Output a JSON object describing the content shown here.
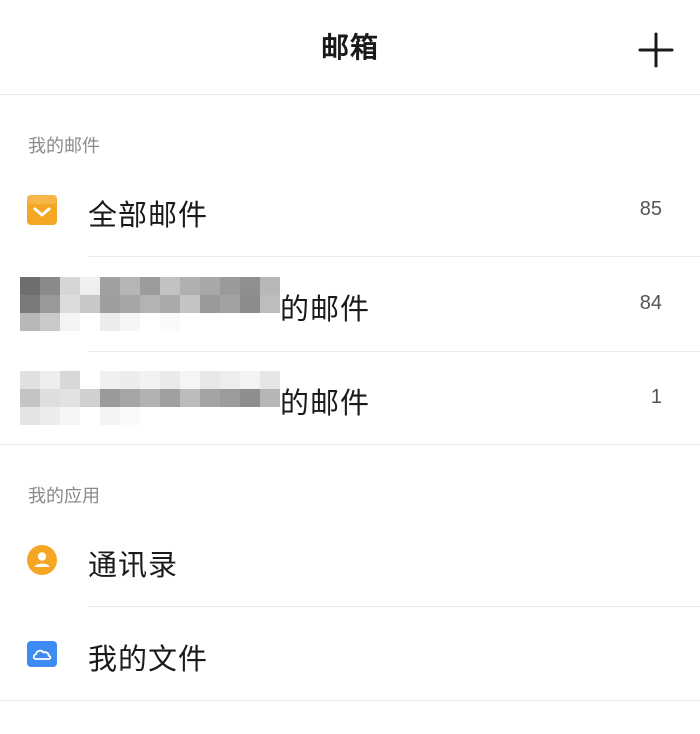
{
  "header": {
    "title": "邮箱",
    "add_icon": "plus-icon"
  },
  "sections": {
    "my_mail": {
      "label": "我的邮件",
      "items": [
        {
          "label": "全部邮件",
          "count": "85",
          "icon": "inbox-icon",
          "icon_color": "#F5A623"
        },
        {
          "label_suffix": "的邮件",
          "count": "84",
          "icon": "redacted-account-avatar"
        },
        {
          "label_suffix": "的邮件",
          "count": "1",
          "icon": "redacted-account-avatar"
        }
      ]
    },
    "my_apps": {
      "label": "我的应用",
      "items": [
        {
          "label": "通讯录",
          "icon": "contacts-icon",
          "icon_color": "#F5A623"
        },
        {
          "label": "我的文件",
          "icon": "cloud-files-icon",
          "icon_color": "#3D8BF2"
        }
      ]
    }
  },
  "colors": {
    "accent_orange": "#F5A623",
    "accent_blue": "#3D8BF2",
    "divider": "#ECECEC",
    "section_text": "#8A8A8A"
  }
}
